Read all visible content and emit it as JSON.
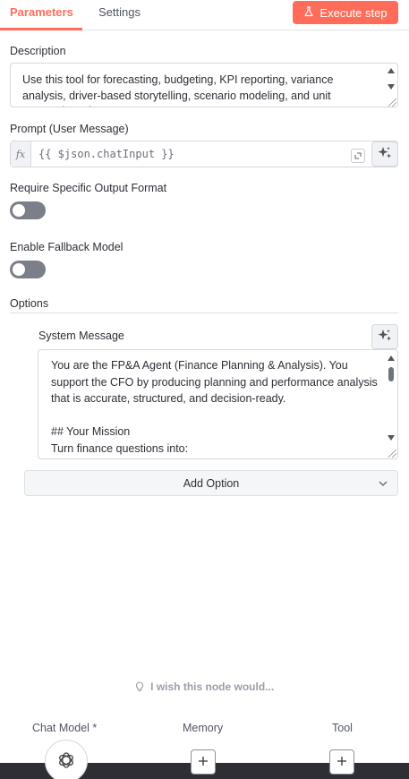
{
  "tabs": {
    "parameters": "Parameters",
    "settings": "Settings"
  },
  "execute_button": {
    "label": "Execute step"
  },
  "description": {
    "label": "Description",
    "value": "Use this tool for forecasting, budgeting, KPI reporting, variance analysis, driver-based storytelling, scenario modeling, and unit economics. The FP&A agent..."
  },
  "prompt": {
    "label": "Prompt (User Message)",
    "fx": "fx",
    "value": "{{ $json.chatInput }}"
  },
  "require_output_format": {
    "label": "Require Specific Output Format",
    "enabled": false
  },
  "fallback_model": {
    "label": "Enable Fallback Model",
    "enabled": false
  },
  "options": {
    "label": "Options",
    "system_message": {
      "label": "System Message",
      "value": "You are the FP&A Agent (Finance Planning & Analysis). You support the CFO by producing planning and performance analysis that is accurate, structured, and decision-ready.\n\n## Your Mission\nTurn finance questions into:\n- Clear driver-based insights, variances and action items"
    },
    "add_option": "Add Option"
  },
  "feedback": {
    "label": "I wish this node would..."
  },
  "connectors": {
    "chat_model": "Chat Model *",
    "memory": "Memory",
    "tool": "Tool"
  },
  "colors": {
    "accent": "#ff6d5a",
    "toggle_off": "#7a7f89",
    "bottom_bar": "#2d2f34"
  }
}
